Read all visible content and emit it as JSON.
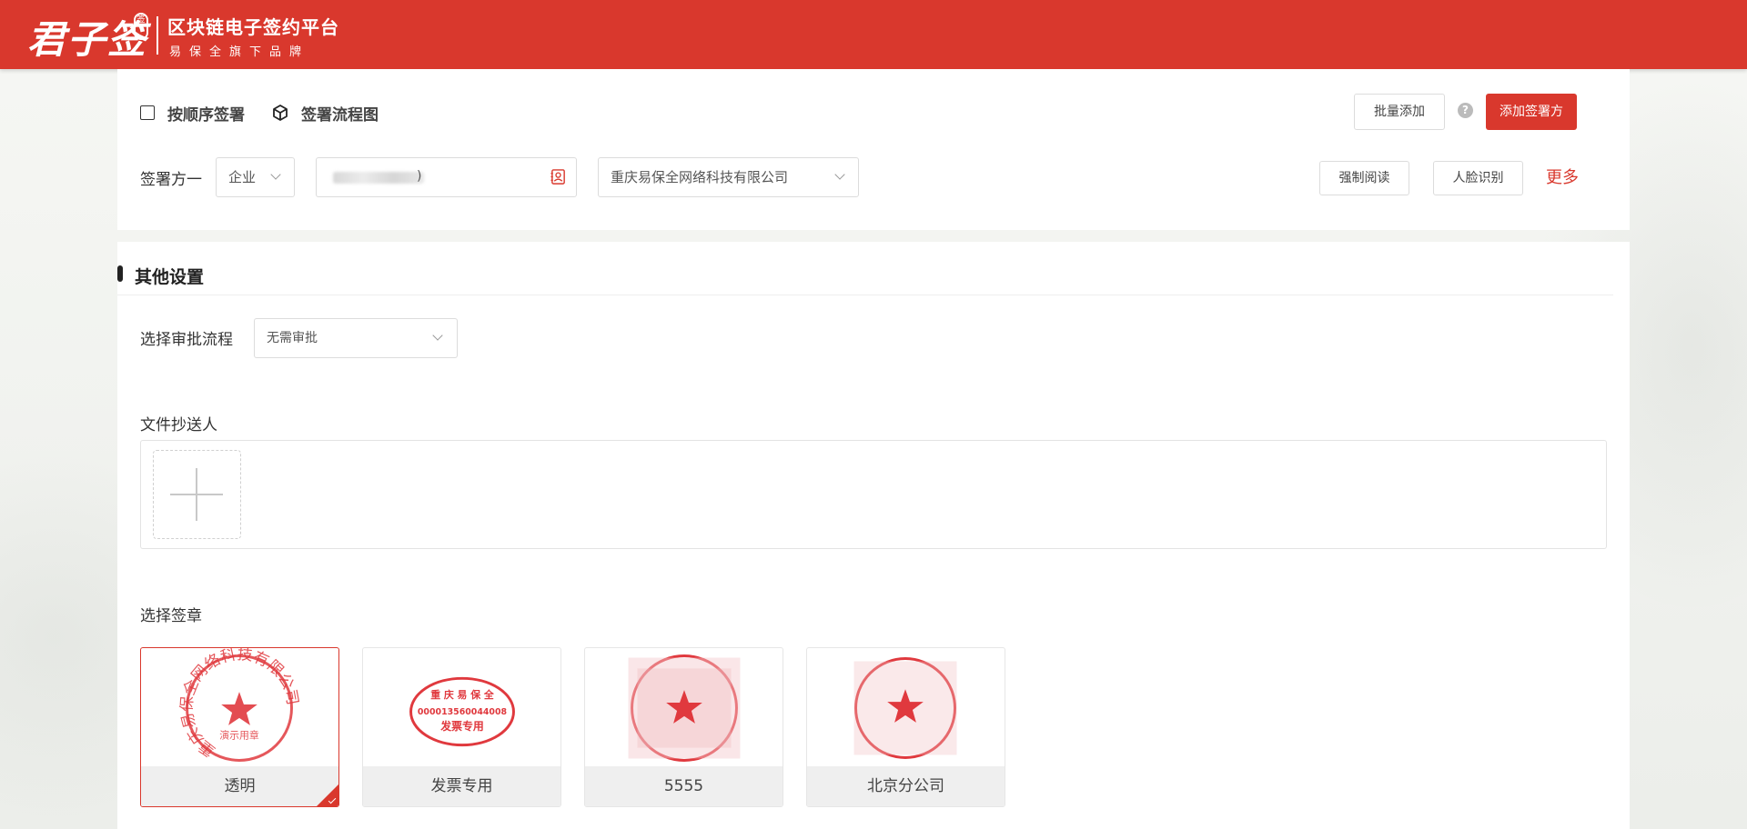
{
  "header": {
    "logo_text": "君子签",
    "logo_seal": "签",
    "title": "区块链电子签约平台",
    "subtitle": "易保全旗下品牌"
  },
  "signing": {
    "sequential_label": "按顺序签署",
    "flow_chart_label": "签署流程图",
    "batch_add": "批量添加",
    "help": "?",
    "add_signer": "添加签署方",
    "signer_label": "签署方一",
    "signer_type": "企业",
    "signer_account_suffix": ")",
    "company": "重庆易保全网络科技有限公司",
    "force_read": "强制阅读",
    "face_recognition": "人脸识别",
    "more": "更多"
  },
  "other_settings": {
    "title": "其他设置",
    "approval_label": "选择审批流程",
    "approval_value": "无需审批",
    "cc_label": "文件抄送人",
    "seal_label": "选择签章"
  },
  "seals": [
    {
      "name": "透明",
      "selected": true,
      "ring_text": "重庆易保全网络科技有限公司",
      "bottom_text": "演示用章"
    },
    {
      "name": "发票专用",
      "selected": false,
      "top_text": "重 庆 易 保 全",
      "number": "000013560044008",
      "bottom_text": "发票专用"
    },
    {
      "name": "5555",
      "selected": false
    },
    {
      "name": "北京分公司",
      "selected": false
    }
  ],
  "colors": {
    "brand_red": "#d9382d",
    "seal_red": "#e0393e"
  }
}
